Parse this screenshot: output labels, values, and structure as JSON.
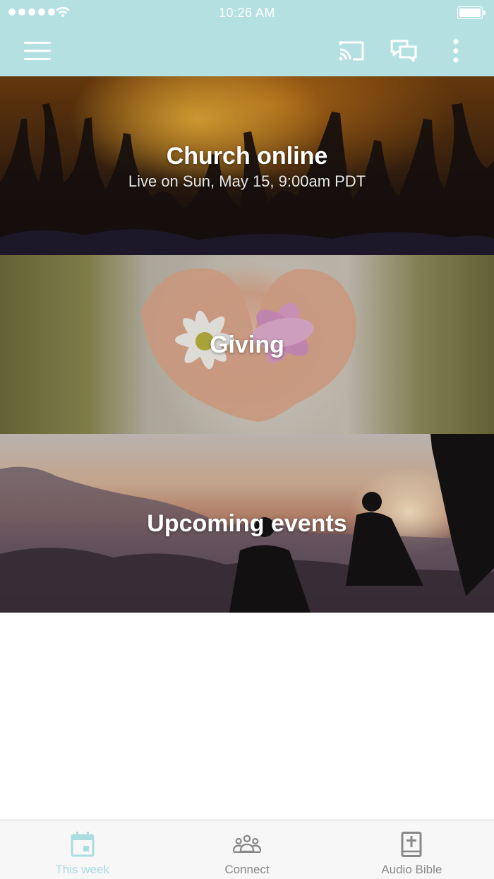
{
  "status_bar": {
    "time": "10:26 AM"
  },
  "app_bar": {
    "menu_icon": "hamburger-menu-icon",
    "actions": [
      "cast-icon",
      "chat-icon",
      "more-vertical-icon"
    ]
  },
  "cards": [
    {
      "title": "Church online",
      "subtitle": "Live on Sun, May 15, 9:00am PDT"
    },
    {
      "title": "Giving"
    },
    {
      "title": "Upcoming events"
    }
  ],
  "tabbar": {
    "tabs": [
      {
        "label": "This week",
        "icon": "calendar-icon",
        "active": true
      },
      {
        "label": "Connect",
        "icon": "people-icon",
        "active": false
      },
      {
        "label": "Audio Bible",
        "icon": "bible-icon",
        "active": false
      }
    ]
  },
  "colors": {
    "app_bar": "#b4e0e2",
    "active_tab": "#a9dde0",
    "inactive_tab": "#888888",
    "tabbar_bg": "#f7f7f7"
  }
}
